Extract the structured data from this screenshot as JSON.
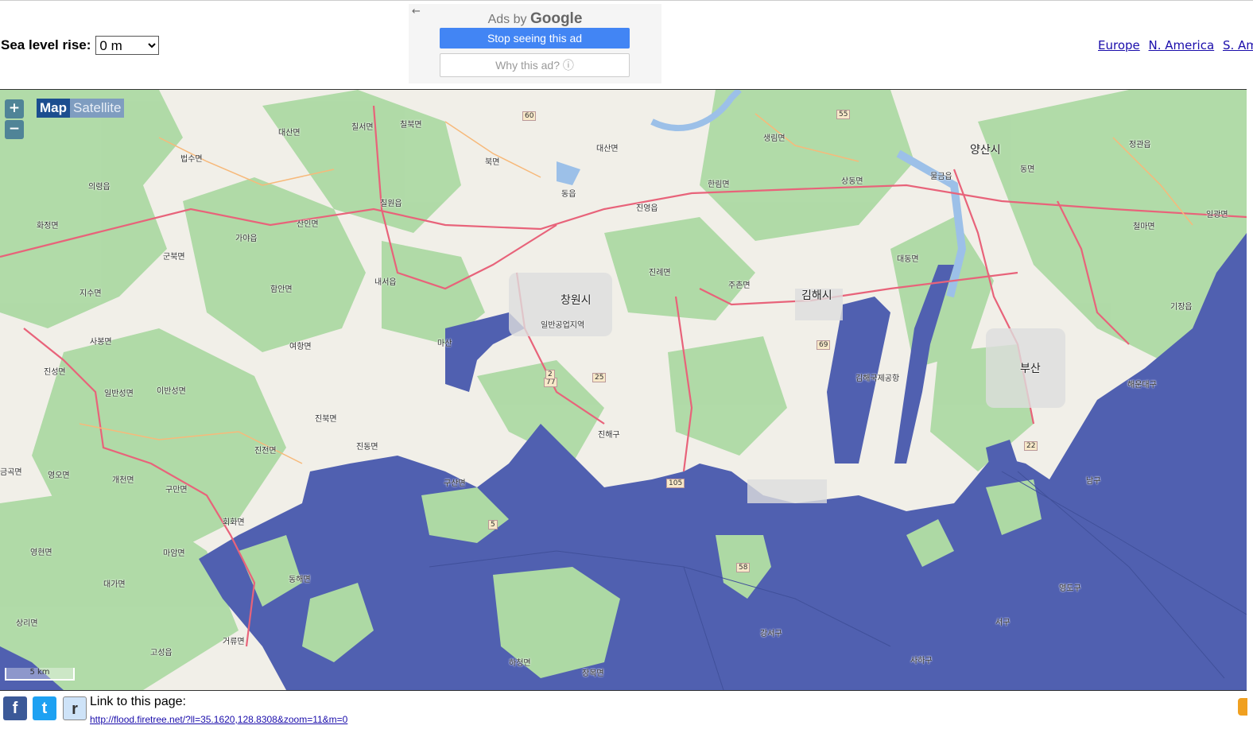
{
  "header": {
    "sea_level_label": "Sea level rise:",
    "sea_level_value": "0 m",
    "ad": {
      "back_arrow": "←",
      "ads_by": "Ads by",
      "google": "Google",
      "stop_label": "Stop seeing this ad",
      "why_label": "Why this ad? ⓘ"
    },
    "regions": [
      "Europe",
      "N. America",
      "S. America"
    ]
  },
  "map": {
    "zoom_in": "+",
    "zoom_out": "−",
    "type_map": "Map",
    "type_satellite": "Satellite",
    "scale_label": "5 km",
    "cities": [
      "창원시",
      "김해시",
      "양산시",
      "부산"
    ],
    "places": [
      "대산면",
      "칠서면",
      "칠북면",
      "북면",
      "대산면",
      "생림면",
      "상동면",
      "정관읍",
      "동면",
      "의령읍",
      "법수면",
      "동읍",
      "칠원읍",
      "진영읍",
      "한림면",
      "물금읍",
      "화정면",
      "가야읍",
      "산인면",
      "군북면",
      "진례면",
      "주촌면",
      "대동면",
      "철마면",
      "일광면",
      "내서읍",
      "지수면",
      "함안면",
      "기장읍",
      "사봉면",
      "여항면",
      "마산",
      "일반공업지역",
      "김해국제공항",
      "진성면",
      "일반성면",
      "이반성면",
      "진해구",
      "해운대구",
      "진북면",
      "진전면",
      "진동면",
      "구산면",
      "금곡면",
      "영오면",
      "개천면",
      "구만면",
      "회화면",
      "동해면",
      "영현면",
      "마암면",
      "대가면",
      "영도구",
      "서구",
      "사하구",
      "강서구",
      "거류면",
      "상리면",
      "고성읍",
      "하청면",
      "장목면",
      "남구"
    ],
    "road_numbers": [
      "60",
      "55",
      "77",
      "25",
      "58",
      "105",
      "22",
      "5",
      "2",
      "69"
    ],
    "colors": {
      "water_flood": "#5060b0",
      "land": "#f2efe9",
      "forest": "#a8d5a0",
      "road": "#e8637a"
    }
  },
  "footer": {
    "facebook": "f",
    "twitter": "t",
    "reddit": "r",
    "link_label": "Link to this page:",
    "link_url": "http://flood.firetree.net/?ll=35.1620,128.8308&zoom=11&m=0"
  }
}
